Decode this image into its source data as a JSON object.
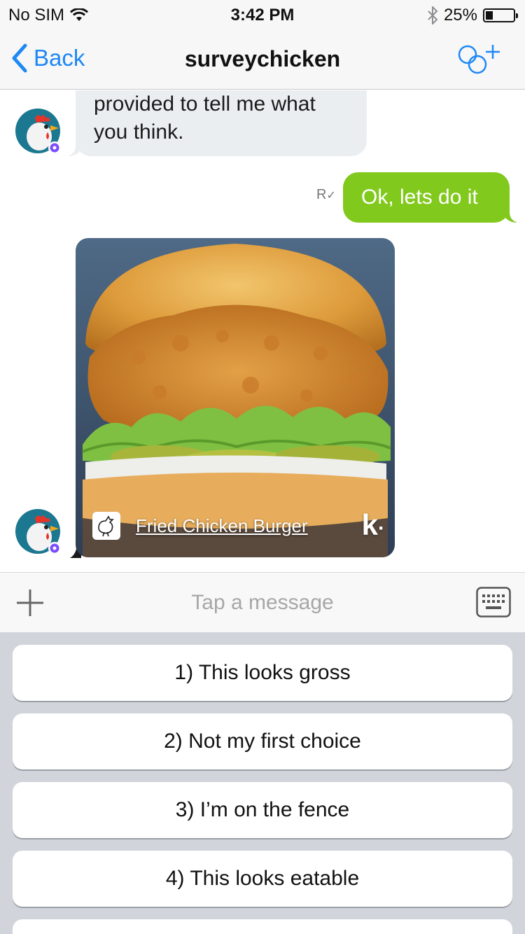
{
  "status_bar": {
    "carrier": "No SIM",
    "time": "3:42 PM",
    "battery_percent": "25%",
    "battery_level": 0.25
  },
  "nav": {
    "back_label": "Back",
    "title": "surveychicken",
    "add_icon": "add-people-icon"
  },
  "messages": {
    "incoming_1": {
      "lines": [
        "provided to tell me what",
        "you think."
      ]
    },
    "outgoing_1": {
      "text": "Ok, lets do it",
      "receipt": "R"
    },
    "card": {
      "caption": "Fried Chicken Burger",
      "brand": "k"
    }
  },
  "input": {
    "placeholder": "Tap a message"
  },
  "suggestions": [
    {
      "label": "1) This looks gross"
    },
    {
      "label": "2) Not my first choice"
    },
    {
      "label": "3) I’m on the fence"
    },
    {
      "label": "4) This looks eatable"
    }
  ],
  "colors": {
    "accent_blue": "#1e88f5",
    "outgoing_bubble": "#82c91e",
    "incoming_bubble": "#ebeef1",
    "suggestion_bg": "#d1d5db"
  }
}
